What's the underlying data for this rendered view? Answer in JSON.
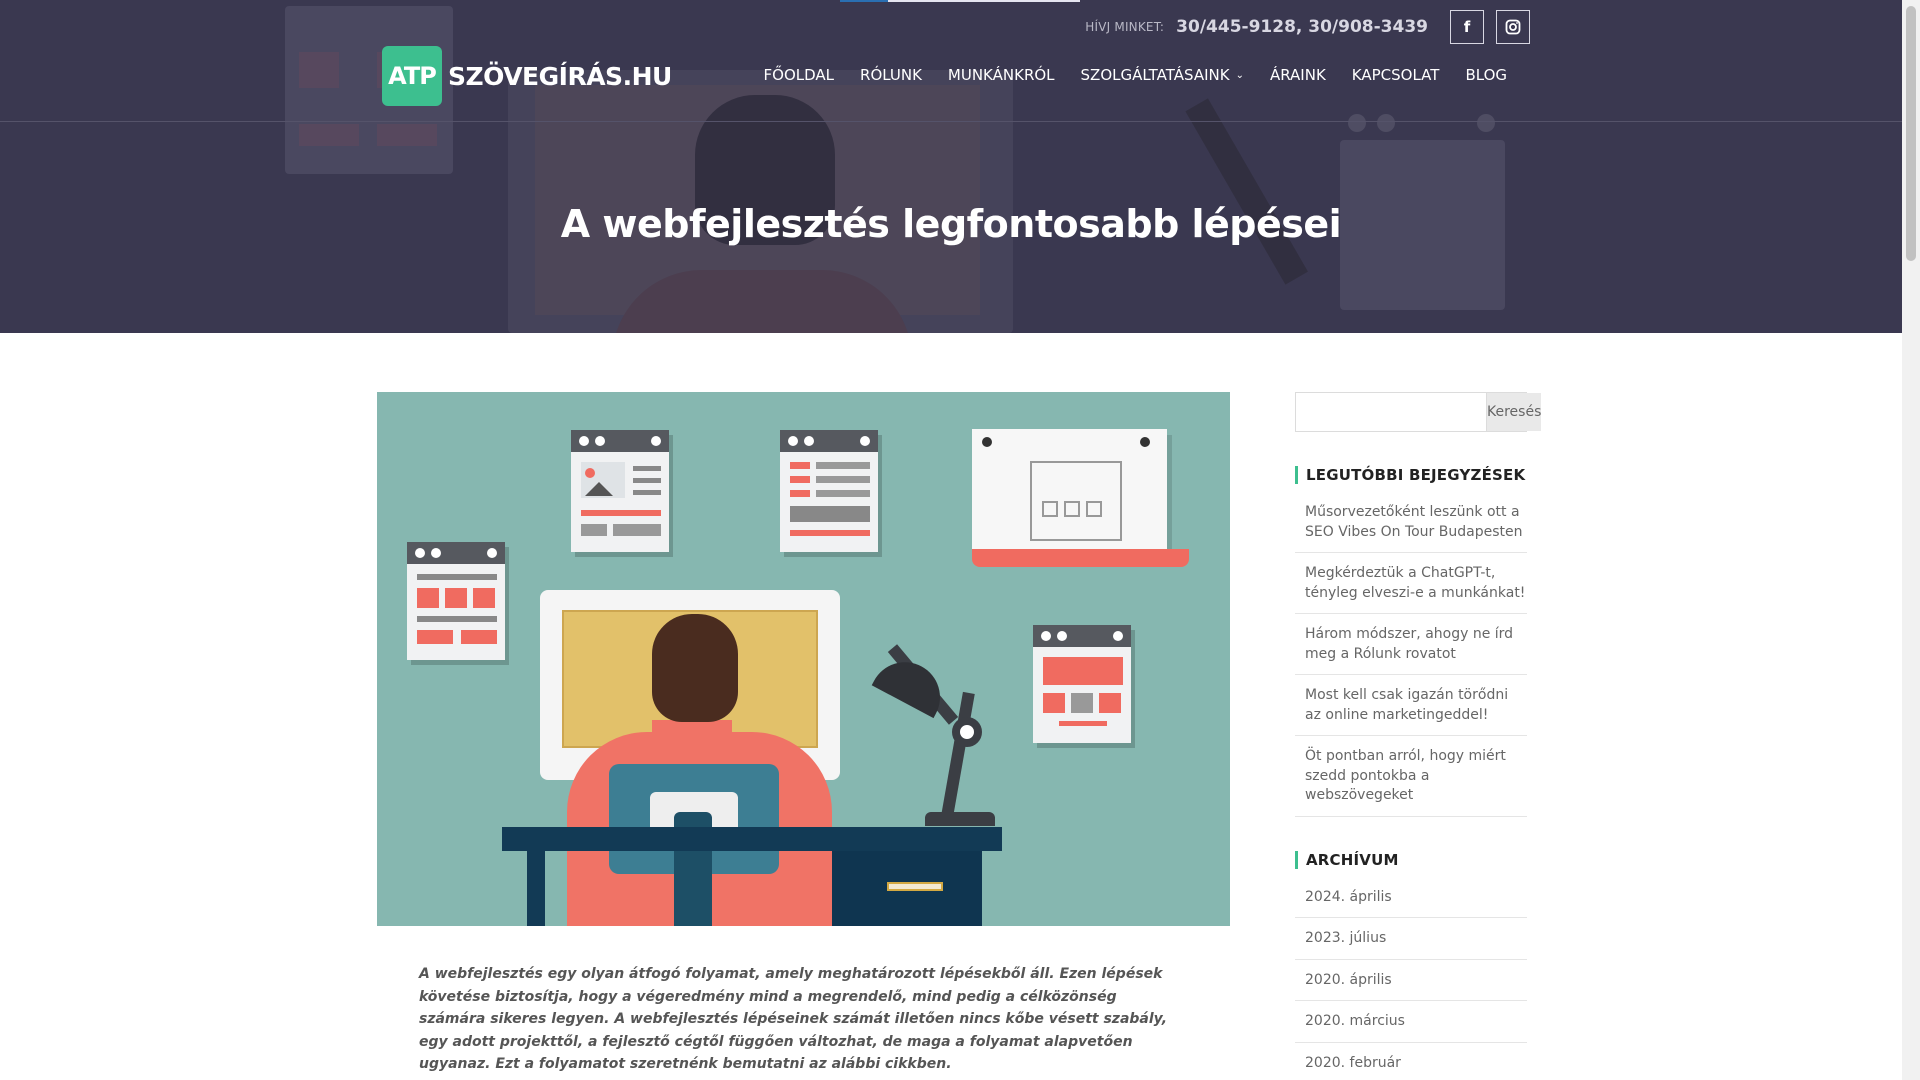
{
  "header": {
    "call_label": "HÍVJ MINKET:",
    "phone_numbers": "30/445-9128, 30/908-3439",
    "social": [
      {
        "name": "facebook-icon",
        "glyph": "f"
      },
      {
        "name": "instagram-icon",
        "glyph": "◘"
      }
    ],
    "logo": {
      "mark": "ATP",
      "text": "SZÖVEGÍRÁS.HU"
    },
    "nav": [
      {
        "label": "FŐOLDAL"
      },
      {
        "label": "RÓLUNK"
      },
      {
        "label": "MUNKÁNKRÓL"
      },
      {
        "label": "SZOLGÁLTATÁSAINK",
        "has_dropdown": true
      },
      {
        "label": "ÁRAINK"
      },
      {
        "label": "KAPCSOLAT"
      },
      {
        "label": "BLOG"
      }
    ],
    "page_title": "A webfejlesztés legfontosabb lépései"
  },
  "article": {
    "intro": "A webfejlesztés egy olyan átfogó folyamat, amely meghatározott lépésekből áll. Ezen lépések követése biztosítja, hogy a végeredmény mind a megrendelő, mind pedig a célközönség számára sikeres legyen. A webfejlesztés lépéseinek számát illetően nincs kőbe vésett szabály, egy adott projekttől, a fejlesztő cégtől függően változhat, de maga a folyamat alapvetően ugyanaz. Ezt a folyamatot szeretnénk bemutatni az alábbi cikkben."
  },
  "sidebar": {
    "search": {
      "placeholder": "",
      "button": "Keresés"
    },
    "recent": {
      "title": "LEGUTÓBBI BEJEGYZÉSEK",
      "items": [
        "Műsorvezetőként leszünk ott a SEO Vibes On Tour Budapesten",
        "Megkérdeztük a ChatGPT-t, tényleg elveszi-e a munkánkat!",
        "Három módszer, ahogy ne írd meg a Rólunk rovatot",
        "Most kell csak igazán törődni az online marketingeddel!",
        "Öt pontban arról, hogy miért szedd pontokba a webszövegeket"
      ]
    },
    "archive": {
      "title": "ARCHÍVUM",
      "items": [
        "2024. április",
        "2023. július",
        "2020. április",
        "2020. március",
        "2020. február"
      ]
    }
  },
  "colors": {
    "hero_bg": "#3a3850",
    "accent": "#3dbf8f",
    "illustration_bg": "#86b7b0"
  }
}
